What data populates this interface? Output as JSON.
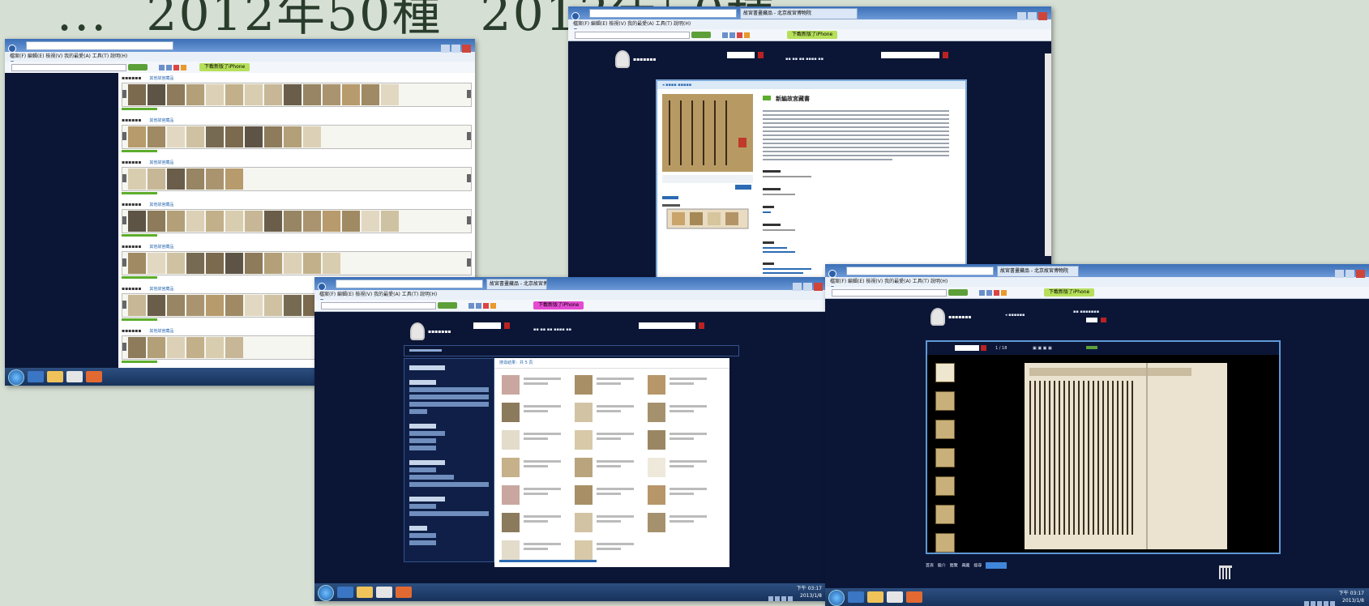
{
  "slide": {
    "title_parts": [
      "...",
      "2012年50種",
      "2013年50種"
    ]
  },
  "browser": {
    "menu": "檔案(F) 編輯(E) 檢視(V) 我的最愛(A) 工具(T) 說明(H)",
    "promo_button": "下載新版了iPhone",
    "tab_title": "故宮書畫藏品 - 北京故宮博物院"
  },
  "gallery": {
    "more_label": "其他故宮藏品",
    "row_count": 8
  },
  "detail": {
    "title": "新編故宮藏書",
    "section_labels": [
      "說明",
      "藏品分類",
      "典藏號",
      "材質",
      "尺寸"
    ]
  },
  "search": {
    "result_count_label": "搜尋結果：共 5 頁"
  },
  "viewer": {
    "page_label": "1 / 18",
    "footer_links": [
      "首頁",
      "簡介",
      "閱覽",
      "典藏",
      "搜尋"
    ]
  },
  "taskbar": {
    "time": "下午 03:17",
    "date": "2013/1/8"
  },
  "colors": {
    "slide_bg": "#d6dfd3",
    "site_bg": "#0b1636",
    "accent_blue": "#5f98d6",
    "promo_green": "#b6e05a"
  }
}
